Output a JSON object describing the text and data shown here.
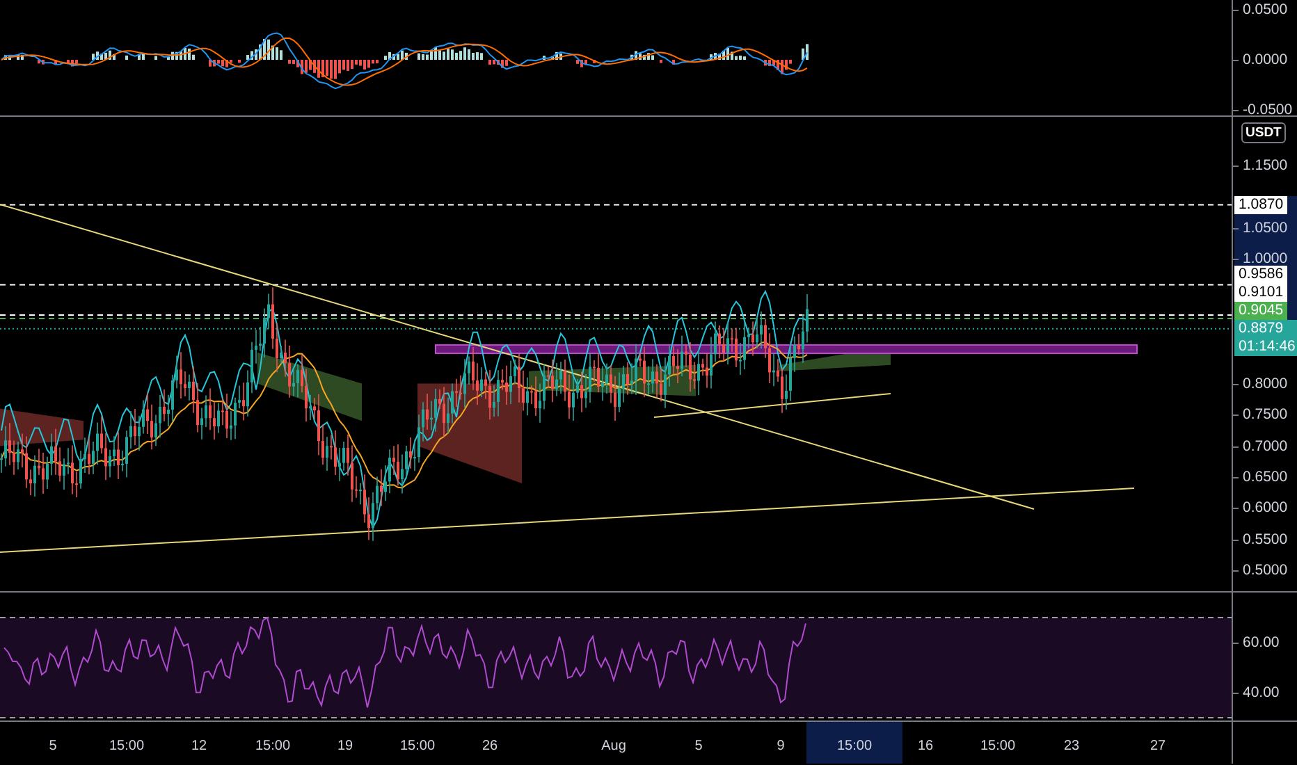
{
  "macd_pane": {
    "axis_labels": [
      "0.0500",
      "0.0000",
      "-0.0500"
    ]
  },
  "price_pane": {
    "currency": "USDT",
    "axis_labels": [
      "1.1500",
      "1.0500",
      "1.0000",
      "0.8000",
      "0.7500",
      "0.7000",
      "0.6500",
      "0.6000",
      "0.5500",
      "0.5000"
    ],
    "price_tags": [
      {
        "text": "1.0870",
        "color": "#ffffff"
      },
      {
        "text": "0.9586",
        "color": "#ffffff"
      },
      {
        "text": "0.9101",
        "color": "#ffffff"
      },
      {
        "text": "0.9045",
        "color": "#4caf50"
      },
      {
        "text": "0.8879",
        "color": "#26a69a",
        "countdown": "01:14:46"
      }
    ]
  },
  "rsi_pane": {
    "axis_labels": [
      "60.00",
      "40.00"
    ]
  },
  "time_axis": {
    "labels": [
      {
        "text": "5",
        "selected": false
      },
      {
        "text": "15:00",
        "selected": false
      },
      {
        "text": "12",
        "selected": false
      },
      {
        "text": "15:00",
        "selected": false
      },
      {
        "text": "19",
        "selected": false
      },
      {
        "text": "15:00",
        "selected": false
      },
      {
        "text": "26",
        "selected": false
      },
      {
        "text": "Aug",
        "selected": false
      },
      {
        "text": "5",
        "selected": false
      },
      {
        "text": "9",
        "selected": false
      },
      {
        "text": "15:00",
        "selected": true
      },
      {
        "text": "16",
        "selected": false
      },
      {
        "text": "15:00",
        "selected": false
      },
      {
        "text": "23",
        "selected": false
      },
      {
        "text": "27",
        "selected": false
      }
    ]
  }
}
